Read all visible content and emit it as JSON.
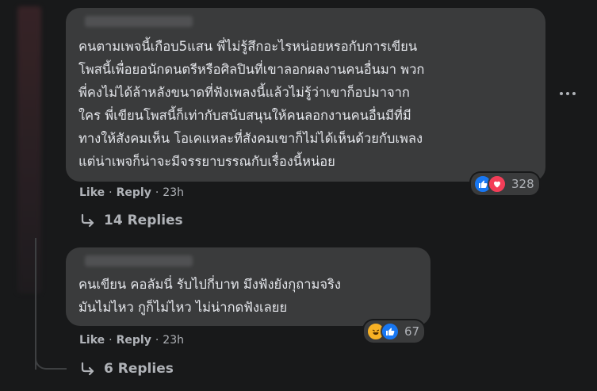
{
  "comments": [
    {
      "text": "คนตามเพจนี้เกือบ5แสน พี่ไม่รู้สึกอะไรหน่อยหรอกับการเขียน\nโพสนี้เพื่อยอนักดนตรีหรือศิลปินที่เขาลอกผลงานคนอื่นมา พวก\nพี่คงไม่ได้ล้าหลังขนาดที่ฟังเพลงนี้แล้วไม่รู้ว่าเขาก็อปมาจาก\nใคร พี่เขียนโพสนี้ก็เท่ากับสนับสนุนให้คนลอกงานคนอื่นมีที่มี\nทางให้สังคมเห็น โอเคแหละที่สังคมเขาก็ไม่ได้เห็นด้วยกับเพลง\nแต่น่าเพจก็น่าจะมีจรรยาบรรณกับเรื่องนี้หน่อย",
      "reactions": {
        "icons": [
          "like-icon",
          "love-icon"
        ],
        "count": "328"
      },
      "like_label": "Like",
      "reply_label": "Reply",
      "time": "23h",
      "replies_label": "14 Replies"
    },
    {
      "text": "คนเขียน คอลัมนี่ รับไปกี่บาท มึงฟังยังกุถามจริง\nมันไม่ไหว กูก็ไม่ไหว ไม่น่ากดฟังเลยย",
      "reactions": {
        "icons": [
          "haha-icon",
          "like-icon"
        ],
        "count": "67"
      },
      "like_label": "Like",
      "reply_label": "Reply",
      "time": "23h",
      "replies_label": "6 Replies"
    }
  ],
  "separator": "·",
  "colors": {
    "background": "#18191a",
    "bubble": "#3a3b3c",
    "text": "#e4e6eb",
    "secondary_text": "#b0b3b8",
    "like_blue": "#1877f2",
    "love_red": "#f33e58",
    "haha_yellow": "#f7b125"
  }
}
